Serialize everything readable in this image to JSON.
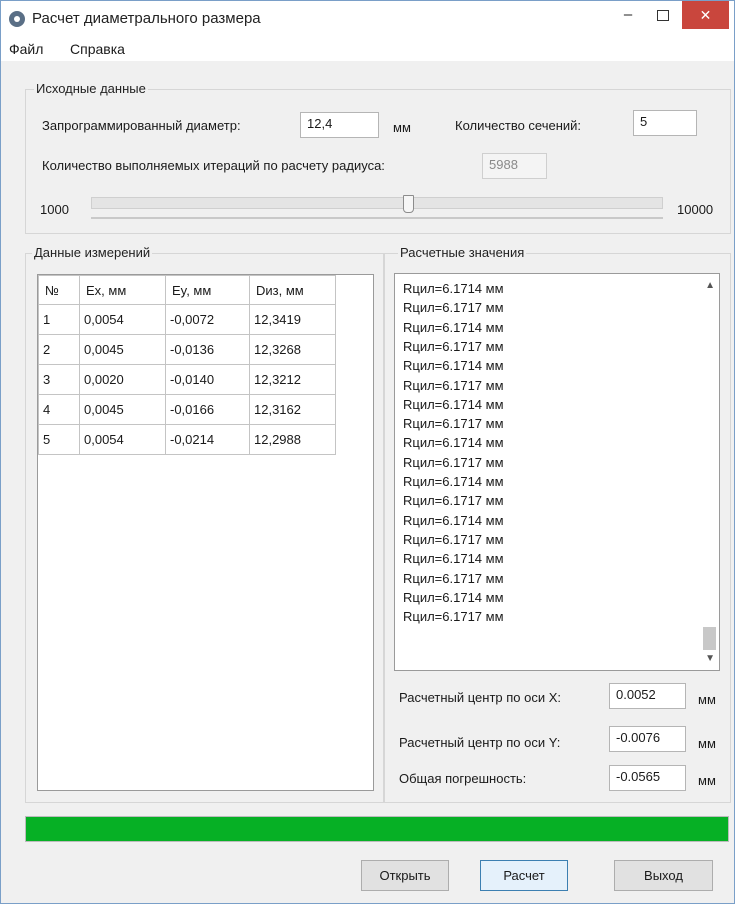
{
  "window": {
    "title": "Расчет диаметрального размера"
  },
  "menu": {
    "file": "Файл",
    "help": "Справка"
  },
  "input_group": {
    "title": "Исходные данные",
    "diameter_label": "Запрограммированный диаметр:",
    "diameter_value": "12,4",
    "diameter_unit": "мм",
    "sections_label": "Количество сечений:",
    "sections_value": "5",
    "iterations_label": "Количество выполняемых итераций по расчету радиуса:",
    "iterations_value": "5988",
    "slider_min": "1000",
    "slider_max": "10000",
    "slider_fraction": 0.554
  },
  "measurements": {
    "title": "Данные измерений",
    "columns": [
      "№",
      "Ex, мм",
      "Ey, мм",
      "Dиз, мм"
    ],
    "rows": [
      [
        "1",
        "0,0054",
        "-0,0072",
        "12,3419"
      ],
      [
        "2",
        "0,0045",
        "-0,0136",
        "12,3268"
      ],
      [
        "3",
        "0,0020",
        "-0,0140",
        "12,3212"
      ],
      [
        "4",
        "0,0045",
        "-0,0166",
        "12,3162"
      ],
      [
        "5",
        "0,0054",
        "-0,0214",
        "12,2988"
      ]
    ]
  },
  "results": {
    "title": "Расчетные значения",
    "list": [
      "Rцил=6.1714 мм",
      "Rцил=6.1717 мм",
      "Rцил=6.1714 мм",
      "Rцил=6.1717 мм",
      "Rцил=6.1714 мм",
      "Rцил=6.1717 мм",
      "Rцил=6.1714 мм",
      "Rцил=6.1717 мм",
      "Rцил=6.1714 мм",
      "Rцил=6.1717 мм",
      "Rцил=6.1714 мм",
      "Rцил=6.1717 мм",
      "Rцил=6.1714 мм",
      "Rцил=6.1717 мм",
      "Rцил=6.1714 мм",
      "Rцил=6.1717 мм",
      "Rцил=6.1714 мм",
      "Rцил=6.1717 мм"
    ],
    "center_x_label": "Расчетный центр по оси X:",
    "center_x_value": "0.0052",
    "center_y_label": "Расчетный центр по оси Y:",
    "center_y_value": "-0.0076",
    "error_label": "Общая погрешность:",
    "error_value": "-0.0565",
    "unit": "мм"
  },
  "progress": {
    "fraction": 1.0,
    "color": "#06b025"
  },
  "buttons": {
    "open": "Открыть",
    "calc": "Расчет",
    "exit": "Выход"
  },
  "colors": {
    "close_button": "#c9463d",
    "accent_border": "#3c7fb1"
  }
}
